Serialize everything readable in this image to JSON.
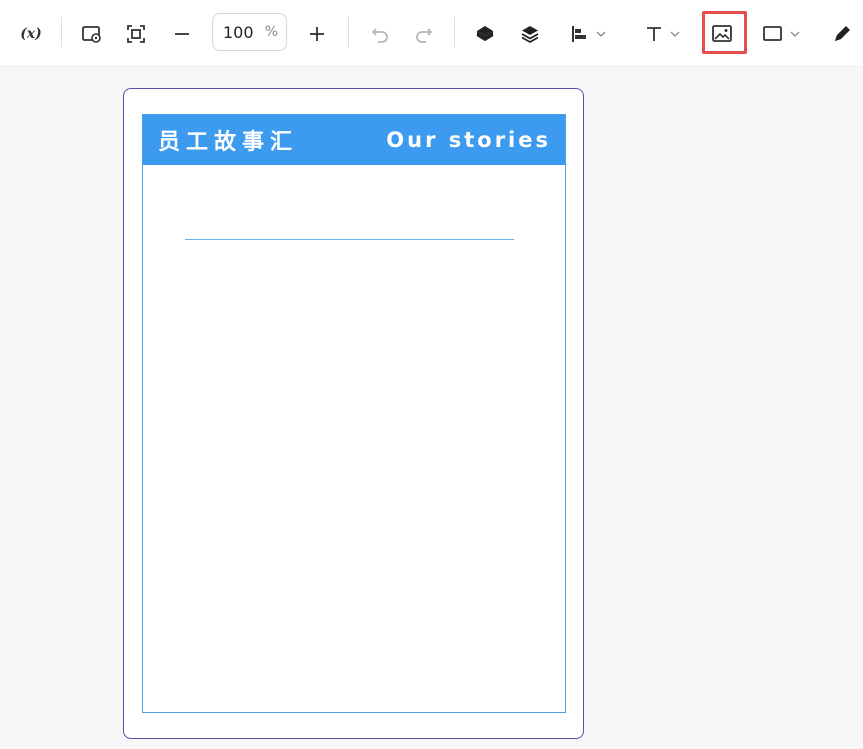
{
  "toolbar": {
    "variable_label": "(x)",
    "zoom": {
      "value": "100",
      "unit": "%"
    },
    "highlighted_tool": "insert-image"
  },
  "poster": {
    "title_cn": "员工故事汇",
    "title_en": "Our stories"
  },
  "colors": {
    "banner": "#3d9bef",
    "highlight": "#e54d4d",
    "frame": "#5a4ea8"
  }
}
